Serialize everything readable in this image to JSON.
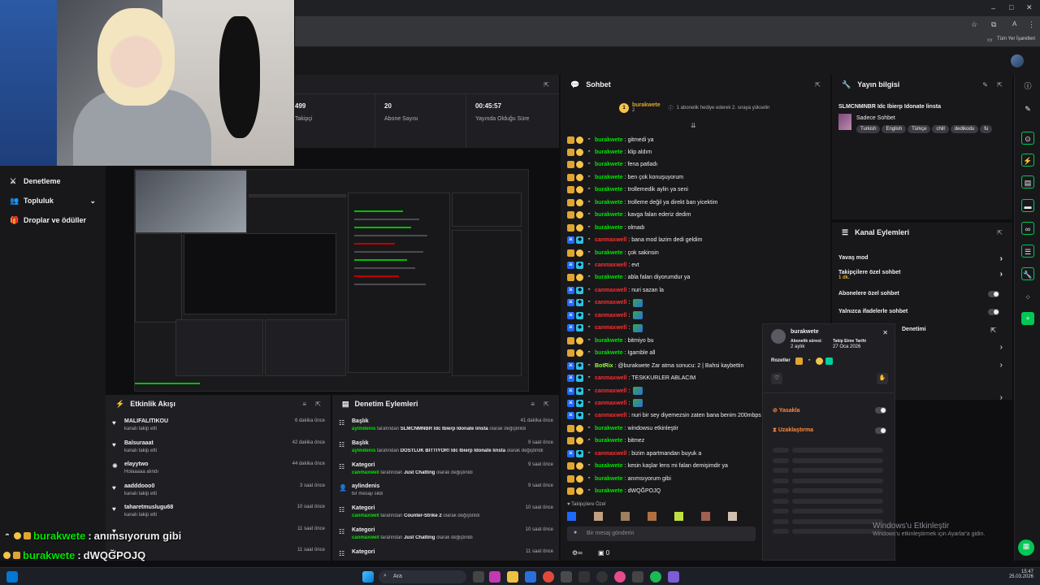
{
  "browser": {
    "bookmarks_label": "Tüm Yer İşaretleri"
  },
  "nav": {
    "items": [
      {
        "label": "Denetleme",
        "icon": "sword-icon"
      },
      {
        "label": "Topluluk",
        "icon": "people-icon"
      },
      {
        "label": "Droplar ve ödüller",
        "icon": "gift-icon"
      }
    ]
  },
  "stats": [
    {
      "value": "499",
      "label": "Takipçi"
    },
    {
      "value": "20",
      "label": "Abone Sayısı"
    },
    {
      "value": "00:45:57",
      "label": "Yayında Olduğu Süre"
    }
  ],
  "activity": {
    "title": "Etkinlik Akışı",
    "items": [
      {
        "name": "MALIFALITIKOU",
        "sub": "kanalı takip etti",
        "time": "6 dakika önce",
        "icon": "heart-icon"
      },
      {
        "name": "Balsuraaat",
        "sub": "kanalı takip etti",
        "time": "42 dakika önce",
        "icon": "heart-icon"
      },
      {
        "name": "elayytwo",
        "sub": "Holaaaaa alındı",
        "time": "44 dakika önce",
        "icon": "points-icon"
      },
      {
        "name": "aadddooo0",
        "sub": "kanalı takip etti",
        "time": "3 saat önce",
        "icon": "heart-icon"
      },
      {
        "name": "taharetmuslugu68",
        "sub": "kanalı takip etti",
        "time": "10 saat önce",
        "icon": "heart-icon"
      },
      {
        "name": "",
        "sub": "",
        "time": "11 saat önce",
        "icon": "heart-icon"
      },
      {
        "name": "",
        "sub": "",
        "time": "11 saat önce",
        "icon": "heart-icon"
      }
    ]
  },
  "modlog": {
    "title": "Denetim Eylemleri",
    "items": [
      {
        "name": "Başlık",
        "user": "aylindenis",
        "mid": "tarafından",
        "target": "SLMCNMNBR Idc Ibierp Idonate linsta",
        "end": "olarak değiştirildi",
        "time": "41 dakika önce"
      },
      {
        "name": "Başlık",
        "user": "aylindenis",
        "mid": "tarafından",
        "target": "DOSTLUK BİTTİYOR! Idc Ibierp Idonate linsta",
        "end": "olarak değiştirildi",
        "time": "9 saat önce"
      },
      {
        "name": "Kategori",
        "user": "canmaxwell",
        "mid": "tarafından",
        "target": "Just Chatting",
        "end": "olarak değiştirildi",
        "time": "9 saat önce"
      },
      {
        "name": "aylindenis",
        "user": "",
        "mid": "bir mesajı sildi",
        "target": "",
        "end": "",
        "time": "9 saat önce"
      },
      {
        "name": "Kategori",
        "user": "canmaxwell",
        "mid": "tarafından",
        "target": "Counter-Strike 2",
        "end": "olarak değiştirildi",
        "time": "10 saat önce"
      },
      {
        "name": "Kategori",
        "user": "canmaxwell",
        "mid": "tarafından",
        "target": "Just Chatting",
        "end": "olarak değiştirildi",
        "time": "10 saat önce"
      },
      {
        "name": "Kategori",
        "user": "",
        "mid": "",
        "target": "",
        "end": "",
        "time": "11 saat önce"
      }
    ]
  },
  "chat": {
    "title": "Sohbet",
    "pinned_user": "burakwete",
    "pinned_count": "2",
    "pinned_text": "1 abonelik hediye ederek 2. sıraya yükselin",
    "lines": [
      {
        "user": "burakwete",
        "color": "g",
        "text": "gitmedi ya",
        "badges": [
          "bc",
          "sub"
        ]
      },
      {
        "user": "burakwete",
        "color": "g",
        "text": "klip aldım",
        "badges": [
          "bc",
          "sub"
        ]
      },
      {
        "user": "burakwete",
        "color": "g",
        "text": "fena patladı",
        "badges": [
          "bc",
          "sub"
        ]
      },
      {
        "user": "burakwete",
        "color": "g",
        "text": "ben çok konuşuyorum",
        "badges": [
          "bc",
          "sub"
        ]
      },
      {
        "user": "burakwete",
        "color": "g",
        "text": "trollemedik aylin ya seni",
        "badges": [
          "bc",
          "sub"
        ]
      },
      {
        "user": "burakwete",
        "color": "g",
        "text": "trolleme değil ya direkt ban yicektim",
        "badges": [
          "bc",
          "sub"
        ]
      },
      {
        "user": "burakwete",
        "color": "g",
        "text": "kavga falan ederiz dedim",
        "badges": [
          "bc",
          "sub"
        ]
      },
      {
        "user": "burakwete",
        "color": "g",
        "text": "olmadı",
        "badges": [
          "bc",
          "sub"
        ]
      },
      {
        "user": "canmaxwell",
        "color": "r",
        "text": "bana mod lazim dedi geldim",
        "badges": [
          "mod",
          "vip"
        ]
      },
      {
        "user": "burakwete",
        "color": "g",
        "text": "çok sakinsin",
        "badges": [
          "bc",
          "sub"
        ]
      },
      {
        "user": "canmaxwell",
        "color": "r",
        "text": "evt",
        "badges": [
          "mod",
          "vip"
        ]
      },
      {
        "user": "burakwete",
        "color": "g",
        "text": "abla falan diyorumdur ya",
        "badges": [
          "bc",
          "sub"
        ]
      },
      {
        "user": "canmaxwell",
        "color": "r",
        "text": "nuri sazan la",
        "badges": [
          "mod",
          "vip"
        ]
      },
      {
        "user": "canmaxwell",
        "color": "r",
        "text": "",
        "badges": [
          "mod",
          "vip"
        ]
      },
      {
        "user": "canmaxwell",
        "color": "r",
        "text": "",
        "badges": [
          "mod",
          "vip"
        ]
      },
      {
        "user": "canmaxwell",
        "color": "r",
        "text": "",
        "badges": [
          "mod",
          "vip"
        ]
      },
      {
        "user": "burakwete",
        "color": "g",
        "text": "bitmiyo bu",
        "badges": [
          "bc",
          "sub"
        ]
      },
      {
        "user": "burakwete",
        "color": "g",
        "text": "Igamble all",
        "badges": [
          "bc",
          "sub"
        ]
      },
      {
        "user": "BotRix",
        "color": "y",
        "text": "@burakwete Zar atma sonucu: 2 | Bahsi kaybettin",
        "badges": [
          "mod",
          "vip"
        ]
      },
      {
        "user": "canmaxwell",
        "color": "r",
        "text": "TESKKURLER ABLACIM",
        "badges": [
          "mod",
          "vip"
        ]
      },
      {
        "user": "canmaxwell",
        "color": "r",
        "text": "",
        "badges": [
          "mod",
          "vip"
        ]
      },
      {
        "user": "canmaxwell",
        "color": "r",
        "text": "",
        "badges": [
          "mod",
          "vip"
        ]
      },
      {
        "user": "canmaxwell",
        "color": "r",
        "text": "nuri bir sey diyemezsin zaten bana benim 200mbps",
        "badges": [
          "mod",
          "vip"
        ]
      },
      {
        "user": "burakwete",
        "color": "g",
        "text": "windowsu etkinleştir",
        "badges": [
          "bc",
          "sub"
        ]
      },
      {
        "user": "burakwete",
        "color": "g",
        "text": "bitmez",
        "badges": [
          "bc",
          "sub"
        ]
      },
      {
        "user": "canmaxwell",
        "color": "r",
        "text": "bizim apartmandan buyuk a",
        "badges": [
          "mod",
          "vip"
        ]
      },
      {
        "user": "burakwete",
        "color": "g",
        "text": "kesin kaşlar lens mi falan demişimdir ya",
        "badges": [
          "bc",
          "sub"
        ]
      },
      {
        "user": "burakwete",
        "color": "g",
        "text": "anımsıyorum gibi",
        "badges": [
          "bc",
          "sub"
        ]
      },
      {
        "user": "burakwete",
        "color": "g",
        "text": "dWQĞPOJQ",
        "badges": [
          "bc",
          "sub"
        ]
      }
    ],
    "followers_label": "Takipçilere Özel",
    "input_placeholder": "Bir mesaj gönderin",
    "footer_count": "0"
  },
  "info": {
    "title": "Yayın bilgisi",
    "stream_title": "SLMCNMNBR Idc Ibierp Idonate linsta",
    "category": "Sadece Sohbet",
    "tags": [
      "Turkish",
      "English",
      "Türkçe",
      "chill",
      "dedikodu",
      "fu"
    ]
  },
  "kanal": {
    "title": "Kanal Eylemleri",
    "rows": [
      {
        "label": "Yavaş mod",
        "sub": ""
      },
      {
        "label": "Takipçilere özel sohbet",
        "sub": "1 dk."
      },
      {
        "label": "Abonelere özel sohbet",
        "sub": ""
      },
      {
        "label": "Yalnızca ifadelerle sohbet",
        "sub": ""
      },
      {
        "label": "Denetimi",
        "sub": ""
      }
    ]
  },
  "usercard": {
    "name": "burakwete",
    "sub_label": "Abonelik süresi:",
    "sub_value": "2 aylık",
    "follow_label": "Takip Etme Tarihi",
    "follow_value": "27 Oca 2026",
    "badges_label": "Rozetler",
    "ban_label": "Yasakla",
    "timeout_label": "Uzaklaştırma"
  },
  "watermark": {
    "title": "Windows'u Etkinleştir",
    "sub": "Windows'u etkinleştirmek için Ayarlar'a gidin."
  },
  "taskbar": {
    "search_placeholder": "Ara",
    "time": "15:47",
    "date": "25.03.2026"
  },
  "overlay": {
    "lines": [
      {
        "user": "burakwete",
        "text": "anımsıyorum gibi"
      },
      {
        "user": "burakwete",
        "text": "dWQĞPOJQ"
      }
    ]
  },
  "colors": {
    "accent_green": "#00e600",
    "mod_red": "#ff2d2d",
    "bg": "#0e0e10",
    "panel": "#1f1f23"
  }
}
